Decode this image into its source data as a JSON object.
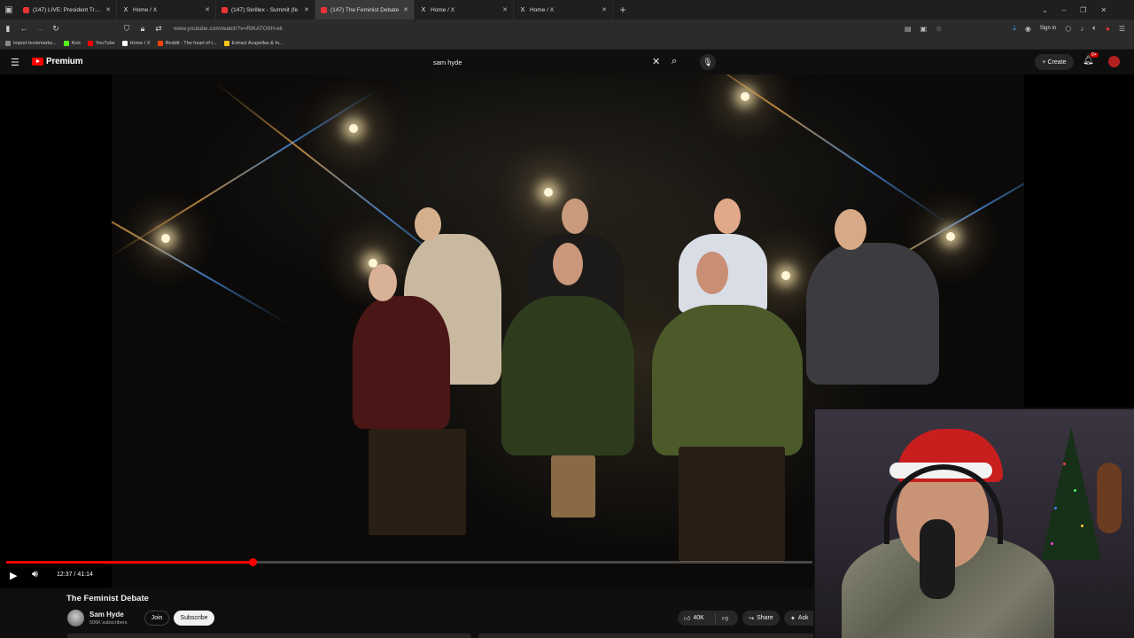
{
  "browser": {
    "tabs": [
      {
        "title": "(147) LIVE: President Trump ma",
        "favicon": "youtube",
        "active": false
      },
      {
        "title": "Home / X",
        "favicon": "x",
        "active": false
      },
      {
        "title": "(147) Skrillex - Summit (fe",
        "favicon": "youtube",
        "active": false
      },
      {
        "title": "(147) The Feminist Debate",
        "favicon": "youtube",
        "active": true
      },
      {
        "title": "Home / X",
        "favicon": "x",
        "active": false
      },
      {
        "title": "Home / X",
        "favicon": "x",
        "active": false
      }
    ],
    "url": "www.youtube.com/watch?v=RIKATO0H-ek",
    "signin_label": "Sign in",
    "bookmarks": [
      {
        "label": "Import bookmarks...",
        "color": "#888888"
      },
      {
        "label": "Kick",
        "color": "#53fc18"
      },
      {
        "label": "YouTube",
        "color": "#ff0000"
      },
      {
        "label": "Home / X",
        "color": "#ffffff"
      },
      {
        "label": "Reddit - The heart of t...",
        "color": "#ff4500"
      },
      {
        "label": "Extract Acapellas & In...",
        "color": "#f5c518"
      }
    ]
  },
  "youtube": {
    "logo_text": "Premium",
    "search_value": "sam hyde",
    "create_label": "Create",
    "notification_count": "9+"
  },
  "player": {
    "current_time": "12:37",
    "time_separator": " / ",
    "duration": "41:14",
    "progress_fraction": 0.306
  },
  "video": {
    "title": "The Feminist Debate",
    "channel_name": "Sam Hyde",
    "subscribers": "506K subscribers",
    "join_label": "Join",
    "subscribe_label": "Subscribe",
    "likes": "40K",
    "share_label": "Share",
    "ask_label": "Ask"
  },
  "colors": {
    "accent": "#ff0000",
    "background": "#0f0f0f",
    "button_bg": "#272727"
  }
}
